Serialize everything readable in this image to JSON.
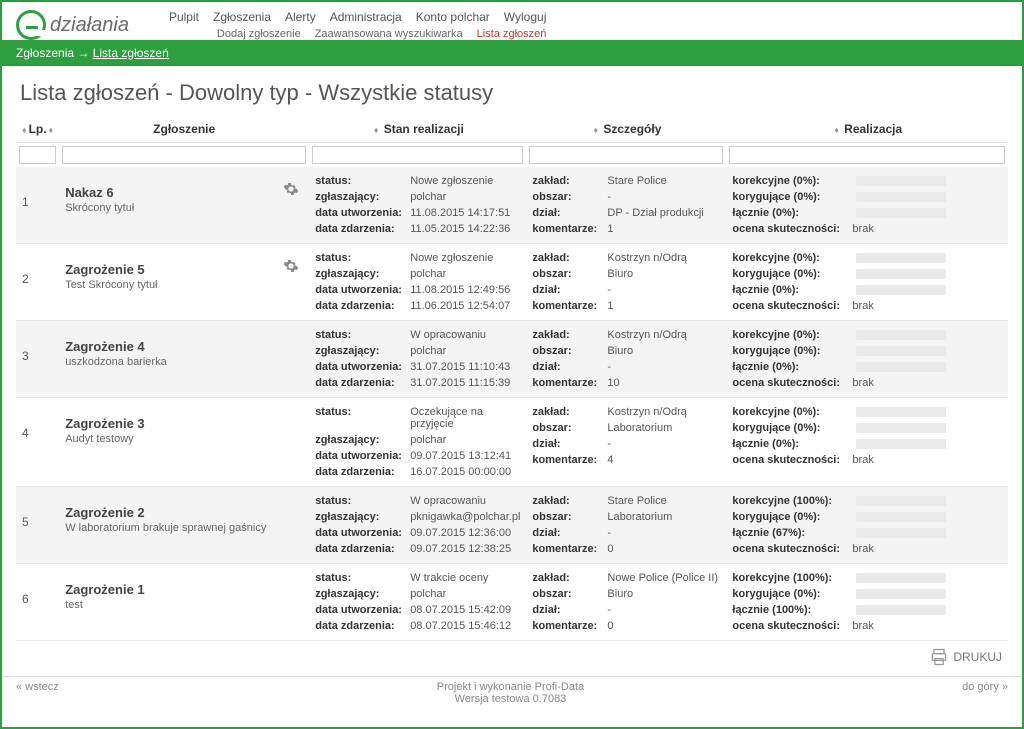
{
  "logo_text": "działania",
  "nav_main": [
    "Pulpit",
    "Zgłoszenia",
    "Alerty",
    "Administracja",
    "Konto polchar",
    "Wyloguj"
  ],
  "nav_sub": [
    {
      "label": "Dodaj zgłoszenie",
      "active": false
    },
    {
      "label": "Zaawansowana wyszukiwarka",
      "active": false
    },
    {
      "label": "Lista zgłoszeń",
      "active": true
    }
  ],
  "breadcrumb": {
    "root": "Zgłoszenia",
    "arrow": "→",
    "current": "Lista zgłoszeń"
  },
  "page_title": "Lista zgłoszeń - Dowolny typ - Wszystkie statusy",
  "columns": {
    "lp": "Lp.",
    "zgl": "Zgłoszenie",
    "stan": "Stan realizacji",
    "szcz": "Szczegóły",
    "real": "Realizacja"
  },
  "labels": {
    "status": "status:",
    "zglaszajacy": "zgłaszający:",
    "data_utw": "data utworzenia:",
    "data_zdarz": "data zdarzenia:",
    "zaklad": "zakład:",
    "obszar": "obszar:",
    "dzial": "dział:",
    "komentarze": "komentarze:",
    "korekcyjne": "korekcyjne",
    "korygujace": "korygujące",
    "lacznie": "łącznie",
    "ocena": "ocena skuteczności:"
  },
  "rows": [
    {
      "lp": "1",
      "title": "Nakaz 6",
      "sub": "Skrócony tytuł",
      "gear": true,
      "status": "Nowe zgłoszenie",
      "zglaszajacy": "polchar",
      "data_utw": "11.08.2015 14:17:51",
      "data_zdarz": "11.05.2015 14:22:36",
      "zaklad": "Stare Police",
      "obszar": "-",
      "dzial": "DP - Dział produkcji",
      "komentarze": "1",
      "korekcyjne_pct": 0,
      "korygujace_pct": 0,
      "lacznie_pct": 0,
      "ocena": "brak"
    },
    {
      "lp": "2",
      "title": "Zagrożenie 5",
      "sub": "Test Skrócony tytuł",
      "gear": true,
      "status": "Nowe zgłoszenie",
      "zglaszajacy": "polchar",
      "data_utw": "11.08.2015 12:49:56",
      "data_zdarz": "11.06.2015 12:54:07",
      "zaklad": "Kostrzyn n/Odrą",
      "obszar": "Biuro",
      "dzial": "-",
      "komentarze": "1",
      "korekcyjne_pct": 0,
      "korygujace_pct": 0,
      "lacznie_pct": 0,
      "ocena": "brak"
    },
    {
      "lp": "3",
      "title": "Zagrożenie 4",
      "sub": "uszkodzona barierka",
      "gear": false,
      "status": "W opracowaniu",
      "zglaszajacy": "polchar",
      "data_utw": "31.07.2015 11:10:43",
      "data_zdarz": "31.07.2015 11:15:39",
      "zaklad": "Kostrzyn n/Odrą",
      "obszar": "Biuro",
      "dzial": "-",
      "komentarze": "10",
      "korekcyjne_pct": 0,
      "korygujace_pct": 0,
      "lacznie_pct": 0,
      "ocena": "brak"
    },
    {
      "lp": "4",
      "title": "Zagrożenie 3",
      "sub": "Audyt testowy",
      "gear": false,
      "status": "Oczekujące na przyjęcie",
      "zglaszajacy": "polchar",
      "data_utw": "09.07.2015 13:12:41",
      "data_zdarz": "16.07.2015 00:00:00",
      "zaklad": "Kostrzyn n/Odrą",
      "obszar": "Laboratorium",
      "dzial": "-",
      "komentarze": "4",
      "korekcyjne_pct": 0,
      "korygujace_pct": 0,
      "lacznie_pct": 0,
      "ocena": "brak"
    },
    {
      "lp": "5",
      "title": "Zagrożenie 2",
      "sub": "W laboratorium brakuje sprawnej gaśnicy",
      "gear": false,
      "status": "W opracowaniu",
      "zglaszajacy": "pknigawka@polchar.pl",
      "data_utw": "09.07.2015 12:36:00",
      "data_zdarz": "09.07.2015 12:38:25",
      "zaklad": "Stare Police",
      "obszar": "Laboratorium",
      "dzial": "-",
      "komentarze": "0",
      "korekcyjne_pct": 100,
      "korygujace_pct": 0,
      "lacznie_pct": 67,
      "ocena": "brak"
    },
    {
      "lp": "6",
      "title": "Zagrożenie 1",
      "sub": "test",
      "gear": false,
      "status": "W trakcie oceny",
      "zglaszajacy": "polchar",
      "data_utw": "08.07.2015 15:42:09",
      "data_zdarz": "08.07.2015 15:46:12",
      "zaklad": "Nowe Police (Police II)",
      "obszar": "Biuro",
      "dzial": "-",
      "komentarze": "0",
      "korekcyjne_pct": 100,
      "korygujace_pct": 0,
      "lacznie_pct": 100,
      "ocena": "brak"
    }
  ],
  "print_label": "DRUKUJ",
  "footer": {
    "back": "« wstecz",
    "center1": "Projekt i wykonanie Profi-Data",
    "center2": "Wersja testowa 0.7083",
    "up": "do góry »"
  }
}
